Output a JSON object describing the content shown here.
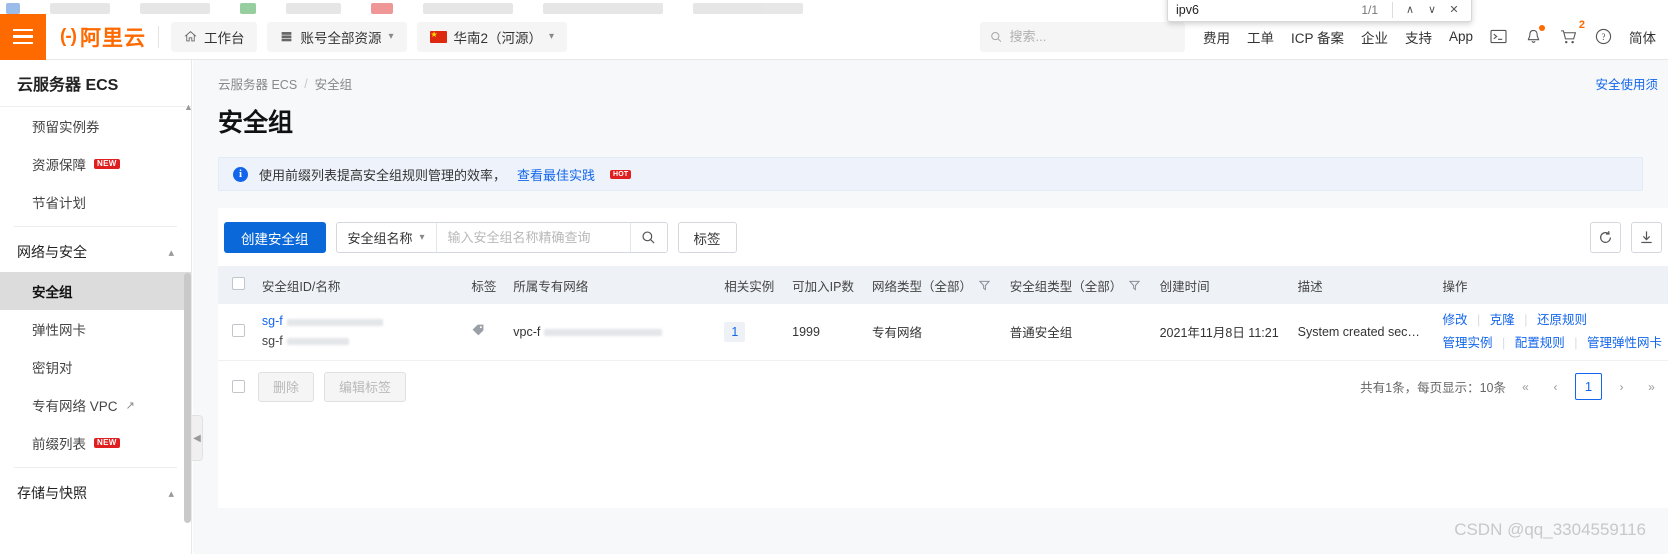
{
  "findbar": {
    "query": "ipv6",
    "count": "1/1",
    "prev_icon": "∧",
    "next_icon": "∨",
    "close_icon": "✕"
  },
  "topbar": {
    "menu_icon": "hamburger-icon",
    "logo_mark": "(-)",
    "logo_text": "阿里云",
    "workbench": "工作台",
    "resources": "账号全部资源",
    "region": "华南2（河源）",
    "search_placeholder": "搜索...",
    "links": [
      "费用",
      "工单",
      "ICP 备案",
      "企业",
      "支持",
      "App"
    ],
    "cart_badge": "2",
    "lang": "简体"
  },
  "sidebar": {
    "product": "云服务器 ECS",
    "items_top": [
      {
        "label": "预留实例券",
        "badge": ""
      },
      {
        "label": "资源保障",
        "badge": "NEW"
      },
      {
        "label": "节省计划",
        "badge": ""
      }
    ],
    "group_network": "网络与安全",
    "items_network": [
      {
        "label": "安全组",
        "badge": "",
        "external": false,
        "active": true
      },
      {
        "label": "弹性网卡",
        "badge": "",
        "external": false,
        "active": false
      },
      {
        "label": "密钥对",
        "badge": "",
        "external": false,
        "active": false
      },
      {
        "label": "专有网络 VPC",
        "badge": "",
        "external": true,
        "active": false
      },
      {
        "label": "前缀列表",
        "badge": "NEW",
        "external": false,
        "active": false
      }
    ],
    "group_storage": "存储与快照"
  },
  "breadcrumb": {
    "root": "云服务器 ECS",
    "sep": "/",
    "current": "安全组",
    "right_link": "安全使用须"
  },
  "page": {
    "title": "安全组"
  },
  "notice": {
    "icon": "info-icon",
    "text": "使用前缀列表提高安全组规则管理的效率，",
    "link": "查看最佳实践",
    "badge": "HOT"
  },
  "toolbar": {
    "create_label": "创建安全组",
    "filter_field": "安全组名称",
    "search_placeholder": "输入安全组名称精确查询",
    "tag_label": "标签",
    "refresh_icon": "refresh-icon",
    "download_icon": "download-icon"
  },
  "table": {
    "columns": [
      {
        "key": "checkbox",
        "label": ""
      },
      {
        "key": "id_name",
        "label": "安全组ID/名称",
        "filter": false
      },
      {
        "key": "tag",
        "label": "标签",
        "filter": false
      },
      {
        "key": "vpc",
        "label": "所属专有网络",
        "filter": false
      },
      {
        "key": "instances",
        "label": "相关实例",
        "filter": false
      },
      {
        "key": "ip_count",
        "label": "可加入IP数",
        "filter": false
      },
      {
        "key": "net_type",
        "label": "网络类型（全部）",
        "filter": true
      },
      {
        "key": "sg_type",
        "label": "安全组类型（全部）",
        "filter": true
      },
      {
        "key": "created",
        "label": "创建时间",
        "filter": false
      },
      {
        "key": "desc",
        "label": "描述",
        "filter": false
      },
      {
        "key": "ops",
        "label": "操作",
        "filter": false
      }
    ],
    "rows": [
      {
        "id": "sg-f",
        "name": "sg-f",
        "tag_icon": "tag-icon",
        "vpc": "vpc-f",
        "instances": "1",
        "ip_count": "1999",
        "net_type": "专有网络",
        "sg_type": "普通安全组",
        "created": "2021年11月8日 11:21",
        "desc": "System created securit...",
        "ops_line1": [
          "修改",
          "克隆",
          "还原规则"
        ],
        "ops_line2": [
          "管理实例",
          "配置规则",
          "管理弹性网卡"
        ]
      }
    ]
  },
  "footer": {
    "delete_label": "删除",
    "edit_tag_label": "编辑标签",
    "total_text": "共有1条，每页显示：10条",
    "first_icon": "«",
    "prev_icon": "‹",
    "current_page": "1",
    "next_icon": "›",
    "last_icon": "»"
  },
  "watermark": "CSDN @qq_3304559116",
  "colors": {
    "brand_orange": "#ff6a00",
    "link_blue": "#1366ec",
    "primary_blue": "#0a68d8",
    "header_bg": "#eef1f6"
  }
}
